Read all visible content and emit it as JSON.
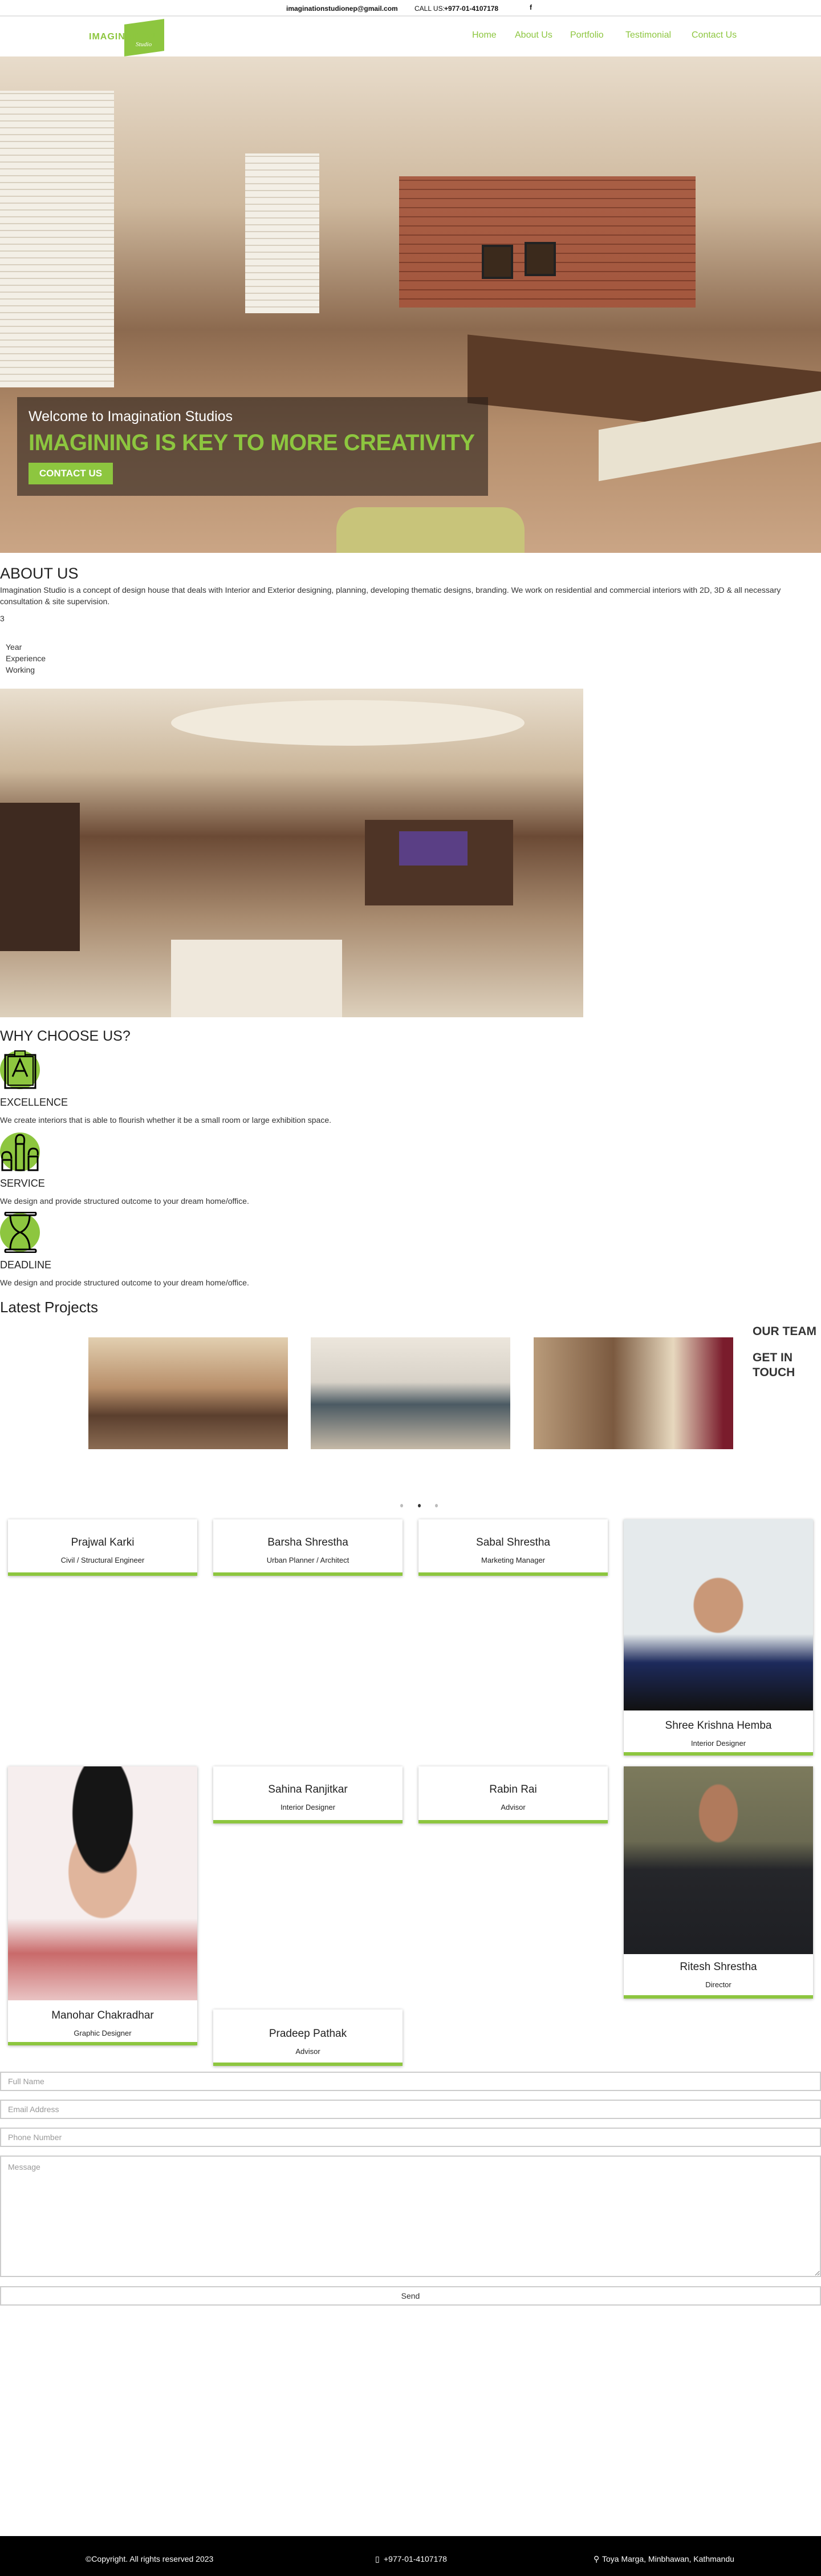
{
  "topbar": {
    "email": "imaginationstudionep@gmail.com",
    "call_label": "CALL US:",
    "phone": "+977-01-4107178",
    "social_icon": "facebook-icon"
  },
  "brand": {
    "logo_text": "IMAGINATION",
    "logo_sub": "Studio",
    "color": "#8dc63f"
  },
  "nav": {
    "items": [
      {
        "label": "Home"
      },
      {
        "label": "About Us"
      },
      {
        "label": "Portfolio"
      },
      {
        "label": "Testimonial"
      },
      {
        "label": "Contact Us"
      }
    ]
  },
  "hero": {
    "welcome": "Welcome to Imagination Studios",
    "headline": "IMAGINING IS KEY TO MORE CREATIVITY",
    "cta": "CONTACT US"
  },
  "about": {
    "title": "ABOUT US",
    "text": "Imagination Studio is a concept of design house that deals with Interior and Exterior designing, planning, developing thematic designs, branding. We work on residential and commercial interiors with 2D, 3D & all necessary consultation & site supervision.",
    "years": "3",
    "stat_lines": [
      "Year",
      "Experience",
      "Working"
    ]
  },
  "why": {
    "title": "WHY CHOOSE US?",
    "features": [
      {
        "title": "EXCELLENCE",
        "icon": "clipboard-grade-icon",
        "text": "We create interiors that is able to flourish whether it be a small room or large exhibition space."
      },
      {
        "title": "SERVICE",
        "icon": "raised-hands-icon",
        "text": "We design and provide structured outcome to your dream home/office."
      },
      {
        "title": "DEADLINE",
        "icon": "hourglass-icon",
        "text": "We design and procide structured outcome to your dream home/office."
      }
    ]
  },
  "projects": {
    "title": "Latest Projects",
    "active_slide": 2,
    "slide_count": 3
  },
  "side": {
    "our_team": "OUR TEAM",
    "get_in_touch": "GET IN TOUCH"
  },
  "team": [
    {
      "name": "Prajwal Karki",
      "role": "Civil / Structural Engineer"
    },
    {
      "name": "Barsha Shrestha",
      "role": "Urban Planner / Architect"
    },
    {
      "name": "Sabal Shrestha",
      "role": "Marketing Manager"
    },
    {
      "name": "Shree Krishna Hemba",
      "role": "Interior Designer"
    },
    {
      "name": "Manohar Chakradhar",
      "role": "Graphic Designer"
    },
    {
      "name": "Sahina Ranjitkar",
      "role": "Interior Designer"
    },
    {
      "name": "Rabin Rai",
      "role": "Advisor"
    },
    {
      "name": "Ritesh Shrestha",
      "role": "Director"
    },
    {
      "name": "Pradeep Pathak",
      "role": "Advisor"
    }
  ],
  "form": {
    "name_placeholder": "Full Name",
    "email_placeholder": "Email Address",
    "phone_placeholder": "Phone Number",
    "message_placeholder": "Message",
    "send": "Send"
  },
  "footer": {
    "copyright": "©Copyright. All rights reserved 2023",
    "phone": "+977-01-4107178",
    "address": "Toya Marga, Minbhawan, Kathmandu"
  }
}
